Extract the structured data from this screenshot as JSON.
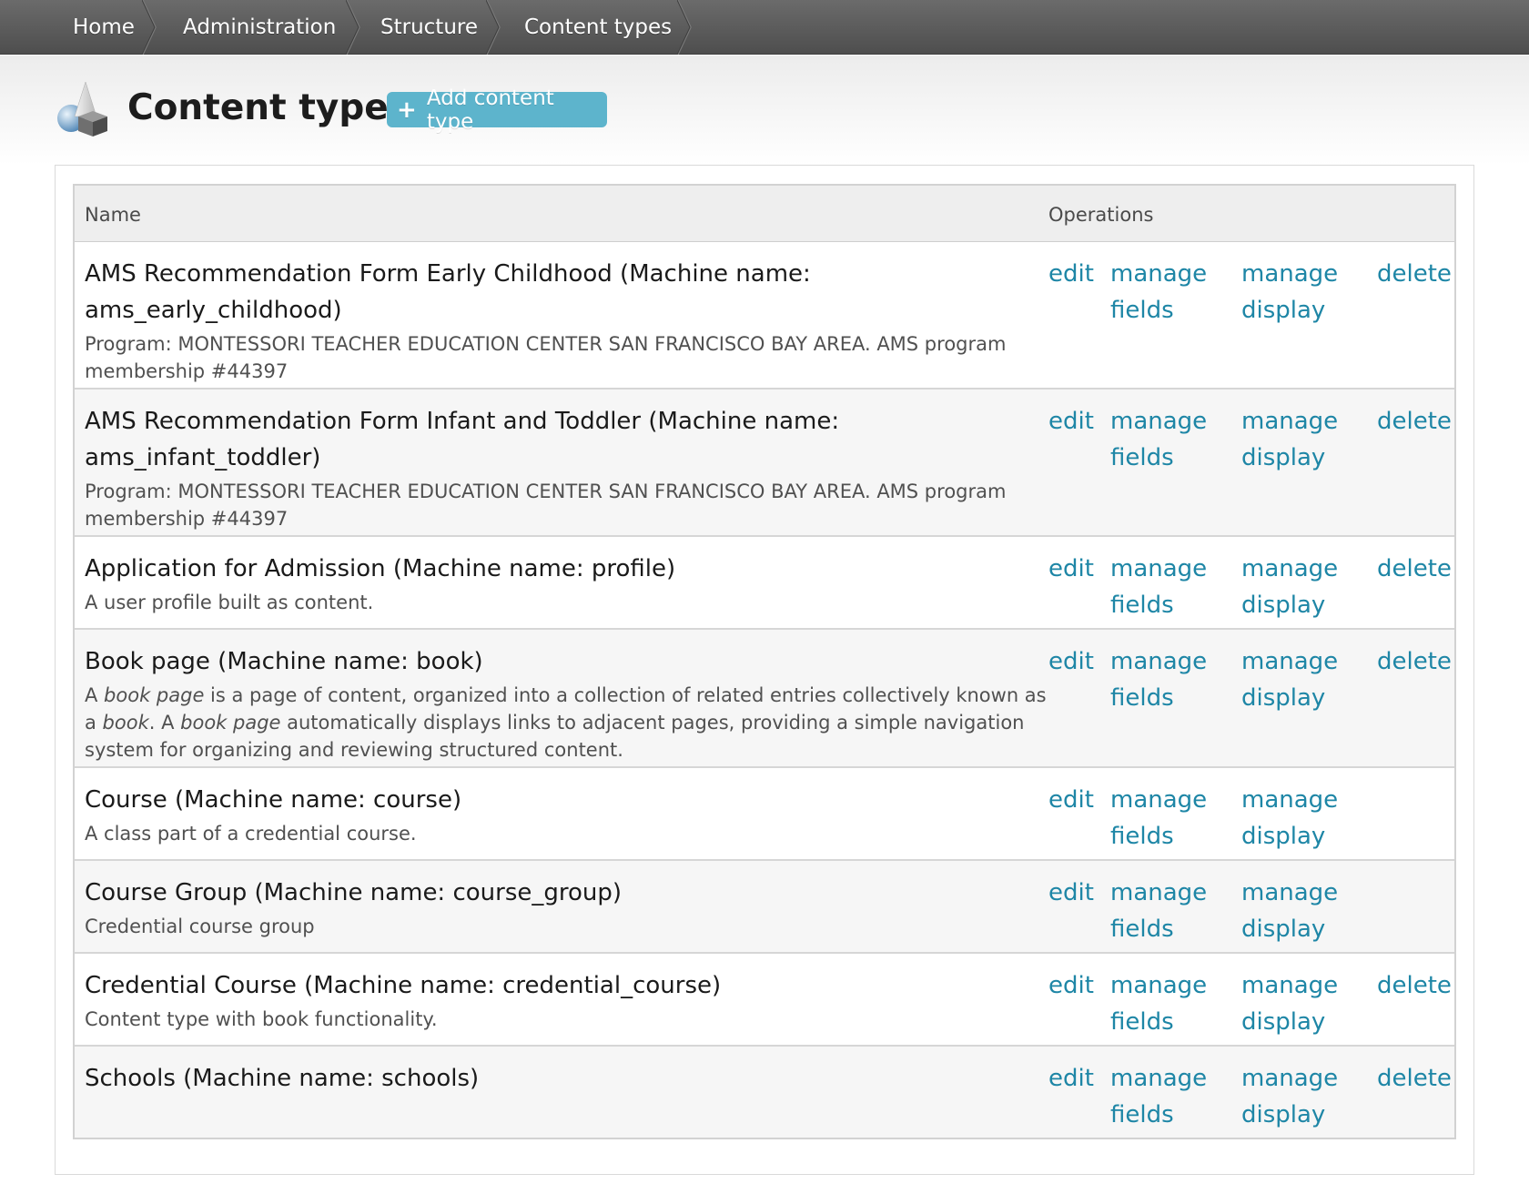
{
  "breadcrumb": [
    "Home",
    "Administration",
    "Structure",
    "Content types"
  ],
  "page": {
    "title": "Content types",
    "add_button_icon": "+",
    "add_button_label": "Add content type"
  },
  "table": {
    "headers": {
      "name": "Name",
      "operations": "Operations"
    },
    "operations": {
      "edit": "edit",
      "manage_fields_1": "manage",
      "manage_fields_2": "fields",
      "manage_display_1": "manage",
      "manage_display_2": "display",
      "delete": "delete"
    },
    "rows": [
      {
        "name": "AMS Recommendation Form Early Childhood (Machine name: ams_early_childhood)",
        "desc": "Program: MONTESSORI TEACHER EDUCATION CENTER SAN FRANCISCO BAY AREA. AMS program membership #44397",
        "deletable": true
      },
      {
        "name": "AMS Recommendation Form Infant and Toddler (Machine name: ams_infant_toddler)",
        "desc": "Program: MONTESSORI TEACHER EDUCATION CENTER SAN FRANCISCO BAY AREA. AMS program membership #44397",
        "deletable": true
      },
      {
        "name": "Application for Admission (Machine name: profile)",
        "desc": "A user profile built as content.",
        "deletable": true
      },
      {
        "name": "Book page (Machine name: book)",
        "desc_parts": [
          {
            "t": "A ",
            "i": false
          },
          {
            "t": "book page",
            "i": true
          },
          {
            "t": " is a page of content, organized into a collection of related entries collectively known as a ",
            "i": false
          },
          {
            "t": "book",
            "i": true
          },
          {
            "t": ". A ",
            "i": false
          },
          {
            "t": "book page",
            "i": true
          },
          {
            "t": " automatically displays links to adjacent pages, providing a simple navigation system for organizing and reviewing structured content.",
            "i": false
          }
        ],
        "deletable": true
      },
      {
        "name": "Course (Machine name: course)",
        "desc": "A class part of a credential course.",
        "deletable": false
      },
      {
        "name": "Course Group (Machine name: course_group)",
        "desc": "Credential course group",
        "deletable": false
      },
      {
        "name": "Credential Course (Machine name: credential_course)",
        "desc": "Content type with book functionality.",
        "deletable": true
      },
      {
        "name": "Schools (Machine name: schools)",
        "desc": "",
        "deletable": true
      }
    ]
  },
  "colors": {
    "link": "#1e86a6",
    "button": "#5db4cc",
    "breadcrumb_bg": "#5a5a5a"
  }
}
